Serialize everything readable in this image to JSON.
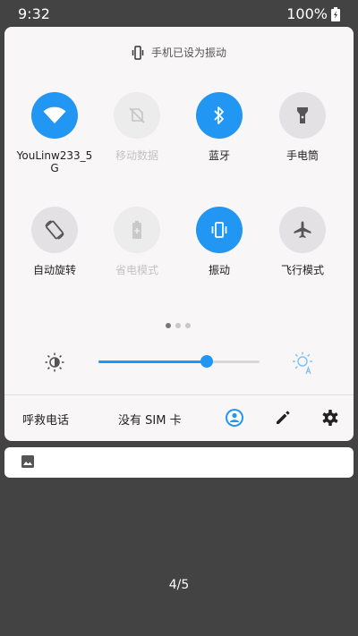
{
  "status_bar": {
    "time": "9:32",
    "battery": "100%"
  },
  "ringer_banner": {
    "icon": "vibrate-icon",
    "text": "手机已设为振动"
  },
  "tiles": [
    {
      "label": "YouLinw233_5G",
      "icon": "wifi-icon",
      "state": "on"
    },
    {
      "label": "移动数据",
      "icon": "mobile-data-off-icon",
      "state": "disabled"
    },
    {
      "label": "蓝牙",
      "icon": "bluetooth-icon",
      "state": "on"
    },
    {
      "label": "手电筒",
      "icon": "flashlight-icon",
      "state": "off"
    },
    {
      "label": "自动旋转",
      "icon": "auto-rotate-icon",
      "state": "off"
    },
    {
      "label": "省电模式",
      "icon": "battery-saver-icon",
      "state": "disabled"
    },
    {
      "label": "振动",
      "icon": "vibrate-icon",
      "state": "on"
    },
    {
      "label": "飞行模式",
      "icon": "airplane-icon",
      "state": "off"
    }
  ],
  "page_dots": {
    "count": 3,
    "active": 0
  },
  "brightness": {
    "level": 0.67,
    "accent": "#2196f3"
  },
  "footer": {
    "emergency": "呼救电话",
    "carrier": "没有 SIM 卡",
    "icons": [
      "user-account-icon",
      "edit-pencil-icon",
      "settings-gear-icon"
    ]
  },
  "notification": {
    "icon": "image-icon"
  },
  "pager": "4/5"
}
